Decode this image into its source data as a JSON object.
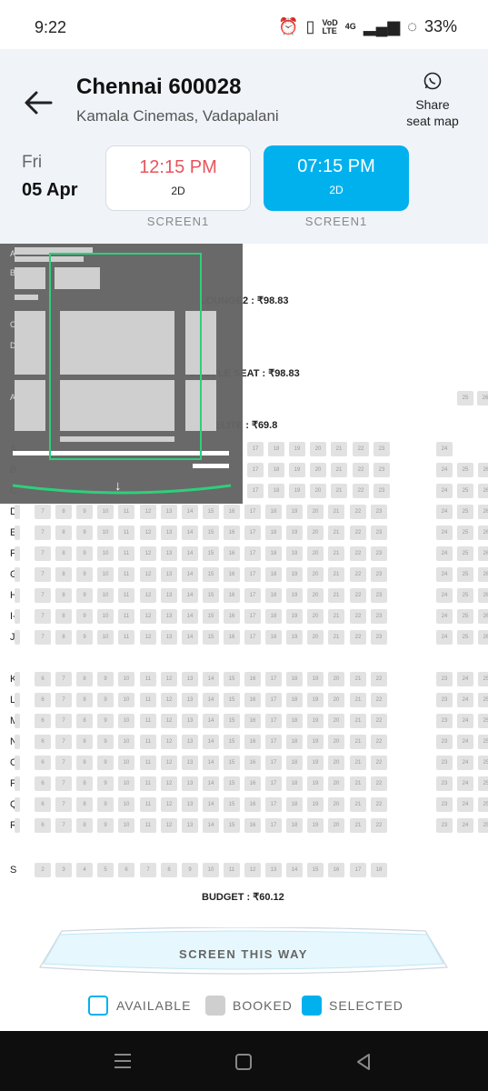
{
  "status": {
    "time": "9:22",
    "volte_top": "VoD",
    "volte_bottom": "LTE",
    "net": "4G",
    "battery": "33%"
  },
  "header": {
    "title": "Chennai 600028",
    "subtitle": "Kamala Cinemas, Vadapalani",
    "share_line1": "Share",
    "share_line2": "seat map",
    "day": "Fri",
    "date": "05 Apr"
  },
  "showtimes": [
    {
      "time": "12:15 PM",
      "format": "2D",
      "screen": "SCREEN1"
    },
    {
      "time": "07:15 PM",
      "format": "2D",
      "screen": "SCREEN1"
    }
  ],
  "sections": {
    "lounge": "LOUNGE2 : ₹98.83",
    "couple": "COUPLE SEAT : ₹98.83",
    "elite": "ELITE : ₹69.8",
    "budget": "BUDGET : ₹60.12"
  },
  "rows": [
    {
      "label": "A",
      "seats": [
        "17",
        "18",
        "19",
        "20",
        "21",
        "22",
        "23"
      ],
      "right": [
        "24"
      ]
    },
    {
      "label": "B",
      "seats": [
        "17",
        "18",
        "19",
        "20",
        "21",
        "22",
        "23"
      ],
      "right": [
        "24",
        "25",
        "26"
      ]
    },
    {
      "label": "C",
      "seats": [
        "17",
        "18",
        "19",
        "20",
        "21",
        "22",
        "23"
      ],
      "right": [
        "24",
        "25",
        "26"
      ]
    },
    {
      "label": "D",
      "seats": [
        "7",
        "8",
        "9",
        "10",
        "11",
        "12",
        "13",
        "14",
        "15",
        "16",
        "17",
        "18",
        "19",
        "20",
        "21",
        "22",
        "23"
      ],
      "right": [
        "24",
        "25",
        "26"
      ]
    },
    {
      "label": "E",
      "seats": [
        "7",
        "8",
        "9",
        "10",
        "11",
        "12",
        "13",
        "14",
        "15",
        "16",
        "17",
        "18",
        "19",
        "20",
        "21",
        "22",
        "23"
      ],
      "right": [
        "24",
        "25",
        "26"
      ]
    },
    {
      "label": "F",
      "seats": [
        "7",
        "8",
        "9",
        "10",
        "11",
        "12",
        "13",
        "14",
        "15",
        "16",
        "17",
        "18",
        "19",
        "20",
        "21",
        "22",
        "23"
      ],
      "right": [
        "24",
        "25",
        "26"
      ]
    },
    {
      "label": "G",
      "seats": [
        "7",
        "8",
        "9",
        "10",
        "11",
        "12",
        "13",
        "14",
        "15",
        "16",
        "17",
        "18",
        "19",
        "20",
        "21",
        "22",
        "23"
      ],
      "right": [
        "24",
        "25",
        "26"
      ]
    },
    {
      "label": "H",
      "seats": [
        "7",
        "8",
        "9",
        "10",
        "11",
        "12",
        "13",
        "14",
        "15",
        "16",
        "17",
        "18",
        "19",
        "20",
        "21",
        "22",
        "23"
      ],
      "right": [
        "24",
        "25",
        "26"
      ]
    },
    {
      "label": "I-",
      "seats": [
        "7",
        "8",
        "9",
        "10",
        "11",
        "12",
        "13",
        "14",
        "15",
        "16",
        "17",
        "18",
        "19",
        "20",
        "21",
        "22",
        "23"
      ],
      "right": [
        "24",
        "25",
        "26"
      ]
    },
    {
      "label": "J",
      "seats": [
        "7",
        "8",
        "9",
        "10",
        "11",
        "12",
        "13",
        "14",
        "15",
        "16",
        "17",
        "18",
        "19",
        "20",
        "21",
        "22",
        "23"
      ],
      "right": [
        "24",
        "25",
        "26"
      ]
    },
    {
      "label": "K",
      "seats": [
        "6",
        "7",
        "8",
        "9",
        "10",
        "11",
        "12",
        "13",
        "14",
        "15",
        "16",
        "17",
        "18",
        "19",
        "20",
        "21",
        "22"
      ],
      "right": [
        "23",
        "24",
        "25"
      ]
    },
    {
      "label": "L",
      "seats": [
        "6",
        "7",
        "8",
        "9",
        "10",
        "11",
        "12",
        "13",
        "14",
        "15",
        "16",
        "17",
        "18",
        "19",
        "20",
        "21",
        "22"
      ],
      "right": [
        "23",
        "24",
        "25"
      ]
    },
    {
      "label": "M",
      "seats": [
        "6",
        "7",
        "8",
        "9",
        "10",
        "11",
        "12",
        "13",
        "14",
        "15",
        "16",
        "17",
        "18",
        "19",
        "20",
        "21",
        "22"
      ],
      "right": [
        "23",
        "24",
        "25"
      ]
    },
    {
      "label": "N",
      "seats": [
        "6",
        "7",
        "8",
        "9",
        "10",
        "11",
        "12",
        "13",
        "14",
        "15",
        "16",
        "17",
        "18",
        "19",
        "20",
        "21",
        "22"
      ],
      "right": [
        "23",
        "24",
        "25"
      ]
    },
    {
      "label": "O",
      "seats": [
        "6",
        "7",
        "8",
        "9",
        "10",
        "11",
        "12",
        "13",
        "14",
        "15",
        "16",
        "17",
        "18",
        "19",
        "20",
        "21",
        "22"
      ],
      "right": [
        "23",
        "24",
        "25"
      ]
    },
    {
      "label": "P",
      "seats": [
        "6",
        "7",
        "8",
        "9",
        "10",
        "11",
        "12",
        "13",
        "14",
        "15",
        "16",
        "17",
        "18",
        "19",
        "20",
        "21",
        "22"
      ],
      "right": [
        "23",
        "24",
        "25"
      ]
    },
    {
      "label": "Q",
      "seats": [
        "6",
        "7",
        "8",
        "9",
        "10",
        "11",
        "12",
        "13",
        "14",
        "15",
        "16",
        "17",
        "18",
        "19",
        "20",
        "21",
        "22"
      ],
      "right": [
        "23",
        "24",
        "25"
      ]
    },
    {
      "label": "R",
      "seats": [
        "6",
        "7",
        "8",
        "9",
        "10",
        "11",
        "12",
        "13",
        "14",
        "15",
        "16",
        "17",
        "18",
        "19",
        "20",
        "21",
        "22"
      ],
      "right": [
        "23",
        "24",
        "25"
      ]
    },
    {
      "label": "S",
      "seats": [
        "2",
        "3",
        "4",
        "5",
        "6",
        "7",
        "8",
        "9",
        "10",
        "11",
        "12",
        "13",
        "14",
        "15",
        "16",
        "17",
        "18"
      ],
      "right": []
    }
  ],
  "lounge_partial": [
    "25",
    "26"
  ],
  "minimap": {
    "labels": [
      "A",
      "B",
      "C",
      "D",
      "A"
    ]
  },
  "screen": {
    "label": "SCREEN THIS WAY"
  },
  "legend": {
    "available": "AVAILABLE",
    "booked": "BOOKED",
    "selected": "SELECTED"
  },
  "colors": {
    "accent": "#00b1ee",
    "selected_time": "#e8545c",
    "booked": "#d6d6d6",
    "header_bg": "#f0f4f9",
    "minimap_frame": "#2ecf7c"
  }
}
